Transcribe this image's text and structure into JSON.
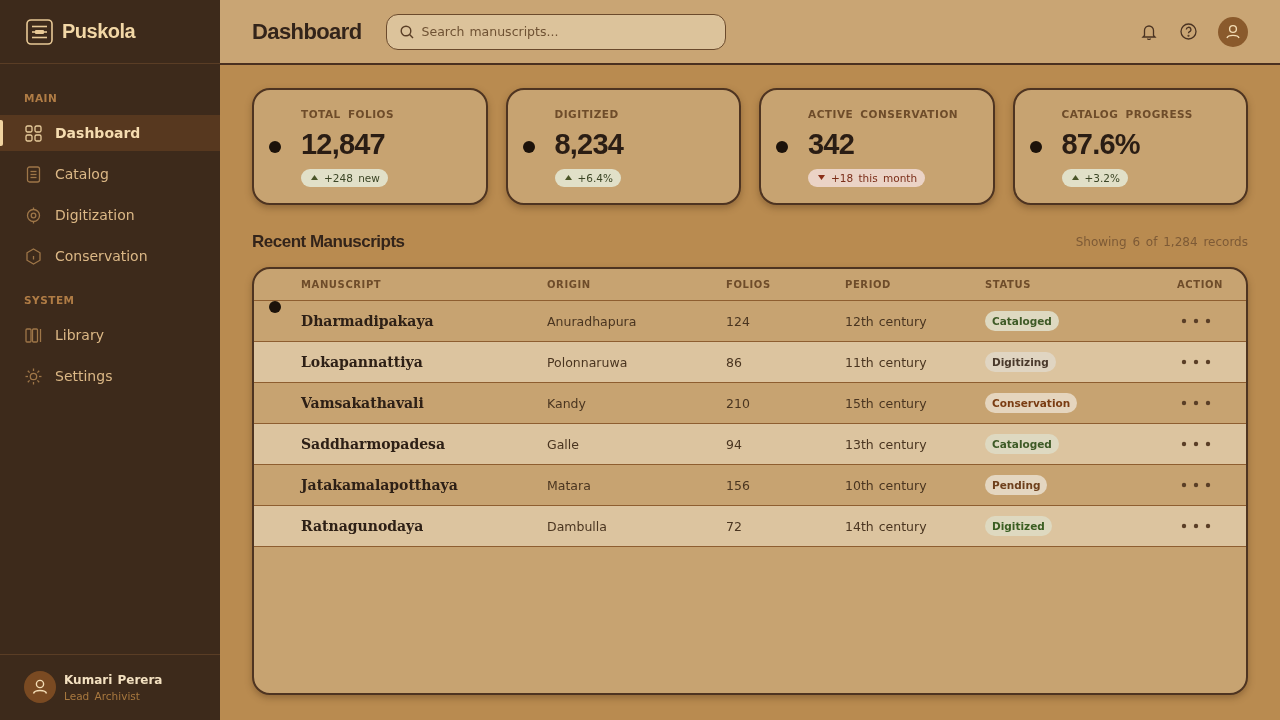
{
  "sidebar": {
    "brand": "Puskola",
    "sections": [
      {
        "title": "MAIN",
        "items": [
          {
            "label": "Dashboard",
            "selected": true
          },
          {
            "label": "Catalog",
            "selected": false
          },
          {
            "label": "Digitization",
            "selected": false
          },
          {
            "label": "Conservation",
            "selected": false
          }
        ]
      },
      {
        "title": "SYSTEM",
        "items": [
          {
            "label": "Library",
            "selected": false
          },
          {
            "label": "Settings",
            "selected": false
          }
        ]
      }
    ],
    "user": {
      "name": "Kumari Perera",
      "role": "Lead Archivist"
    }
  },
  "header": {
    "title": "Dashboard",
    "search": {
      "placeholder": "Search manuscripts..."
    }
  },
  "stats": [
    {
      "label": "TOTAL FOLIOS",
      "value": "12,847",
      "delta": "+248 new",
      "kind": "up"
    },
    {
      "label": "DIGITIZED",
      "value": "8,234",
      "delta": "+6.4%",
      "kind": "up"
    },
    {
      "label": "ACTIVE CONSERVATION",
      "value": "342",
      "delta": "+18 this month",
      "kind": "down"
    },
    {
      "label": "CATALOG PROGRESS",
      "value": "87.6%",
      "delta": "+3.2%",
      "kind": "up"
    }
  ],
  "recent": {
    "title": "Recent Manuscripts",
    "summary": "Showing 6 of 1,284 records",
    "columns": [
      "MANUSCRIPT",
      "ORIGIN",
      "FOLIOS",
      "PERIOD",
      "STATUS",
      "ACTION"
    ],
    "rows": [
      {
        "manuscript": "Dharmadipakaya",
        "origin": "Anuradhapura",
        "folios": "124",
        "period": "12th century",
        "status": {
          "label": "Cataloged",
          "color": "#3e5a26"
        }
      },
      {
        "manuscript": "Lokapannattiya",
        "origin": "Polonnaruwa",
        "folios": "86",
        "period": "11th century",
        "status": {
          "label": "Digitizing",
          "color": "#4a3a2c"
        }
      },
      {
        "manuscript": "Vamsakathavali",
        "origin": "Kandy",
        "folios": "210",
        "period": "15th century",
        "status": {
          "label": "Conservation",
          "color": "#7a3c12"
        }
      },
      {
        "manuscript": "Saddharmopadesa",
        "origin": "Galle",
        "folios": "94",
        "period": "13th century",
        "status": {
          "label": "Cataloged",
          "color": "#3e5a26"
        }
      },
      {
        "manuscript": "Jatakamalapotthaya",
        "origin": "Matara",
        "folios": "156",
        "period": "10th century",
        "status": {
          "label": "Pending",
          "color": "#6e401c"
        }
      },
      {
        "manuscript": "Ratnagunodaya",
        "origin": "Dambulla",
        "folios": "72",
        "period": "14th century",
        "status": {
          "label": "Digitized",
          "color": "#3a5e22"
        }
      }
    ]
  }
}
